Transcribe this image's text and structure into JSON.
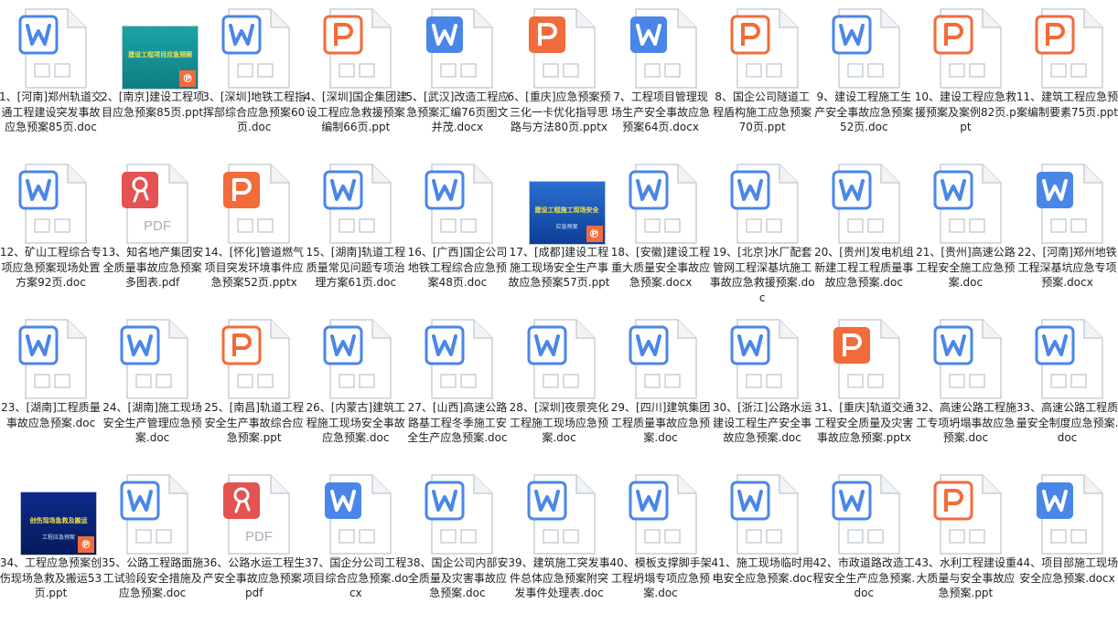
{
  "colors": {
    "word": "#4a86e8",
    "ppt": "#f26b3a",
    "pdf": "#e45252",
    "label_text": "#222222"
  },
  "files": [
    {
      "name": "1、[河南]郑州轨道交通工程建设突发事故应急预案85页.doc",
      "type": "doc",
      "icon": "word-outline-icon"
    },
    {
      "name": "2、[南京]建设工程项目应急预案85页.ppt",
      "type": "ppt",
      "icon": "slide-thumbnail",
      "thumb_text": "建设工程项目应急预案",
      "thumb_sub": ""
    },
    {
      "name": "3、[深圳]地铁工程指挥部综合应急预案60页.doc",
      "type": "doc",
      "icon": "word-outline-icon"
    },
    {
      "name": "4、[深圳]国企集团建设工程应急救援预案编制66页.ppt",
      "type": "ppt",
      "icon": "ppt-outline-icon"
    },
    {
      "name": "5、[武汉]改造工程应急预案汇编76页图文并茂.docx",
      "type": "docx",
      "icon": "word-solid-icon"
    },
    {
      "name": "6、[重庆]应急预案预三化一卡优化指导思路与方法80页.pptx",
      "type": "pptx",
      "icon": "ppt-solid-icon"
    },
    {
      "name": "7、工程项目管理现场生产安全事故应急预案64页.docx",
      "type": "docx",
      "icon": "word-solid-icon"
    },
    {
      "name": "8、国企公司隧道工程盾构施工应急预案70页.ppt",
      "type": "ppt",
      "icon": "ppt-outline-icon"
    },
    {
      "name": "9、建设工程施工生产安全事故应急预案52页.doc",
      "type": "doc",
      "icon": "word-outline-icon"
    },
    {
      "name": "10、建设工程应急救援预案及案例82页.ppt",
      "type": "ppt",
      "icon": "ppt-outline-icon"
    },
    {
      "name": "11、建筑工程应急预案编制要素75页.ppt",
      "type": "ppt",
      "icon": "ppt-outline-icon"
    },
    {
      "name": "12、矿山工程综合专项应急预案现场处置方案92页.doc",
      "type": "doc",
      "icon": "word-outline-icon"
    },
    {
      "name": "13、知名地产集团安全质量事故应急预案多图表.pdf",
      "type": "pdf",
      "icon": "pdf-icon",
      "pdf_text": "PDF"
    },
    {
      "name": "14、[怀化]管道燃气项目突发环境事件应急预案52页.pptx",
      "type": "pptx",
      "icon": "ppt-solid-icon"
    },
    {
      "name": "15、[湖南]轨道工程质量常见问题专项治理方案61页.doc",
      "type": "doc",
      "icon": "word-outline-icon"
    },
    {
      "name": "16、[广西]国企公司地铁工程综合应急预案48页.doc",
      "type": "doc",
      "icon": "word-outline-icon"
    },
    {
      "name": "17、[成都]建设工程施工现场安全生产事故应急预案57页.ppt",
      "type": "ppt",
      "icon": "slide-thumbnail",
      "thumb_text": "建设工程施工现场安全",
      "thumb_sub": "应急预案"
    },
    {
      "name": "18、[安徽]建设工程重大质量安全事故应急预案.docx",
      "type": "docx",
      "icon": "word-outline-icon"
    },
    {
      "name": "19、[北京]水厂配套管网工程深基坑施工事故应急救援预案.doc",
      "type": "doc",
      "icon": "word-outline-icon"
    },
    {
      "name": "20、[贵州]发电机组新建工程工程质量事故应急预案.doc",
      "type": "doc",
      "icon": "word-outline-icon"
    },
    {
      "name": "21、[贵州]高速公路工程安全施工应急预案.doc",
      "type": "doc",
      "icon": "word-outline-icon"
    },
    {
      "name": "22、[河南]郑州地铁工程深基坑应急专项预案.docx",
      "type": "docx",
      "icon": "word-solid-icon"
    },
    {
      "name": "23、[湖南]工程质量事故应急预案.doc",
      "type": "doc",
      "icon": "word-outline-icon"
    },
    {
      "name": "24、[湖南]施工现场安全生产管理应急预案.doc",
      "type": "doc",
      "icon": "word-outline-icon"
    },
    {
      "name": "25、[南昌]轨道工程安全生产事故综合应急预案.ppt",
      "type": "ppt",
      "icon": "ppt-outline-icon"
    },
    {
      "name": "26、[内蒙古]建筑工程施工现场安全事故应急预案.doc",
      "type": "doc",
      "icon": "word-outline-icon"
    },
    {
      "name": "27、[山西]高速公路路基工程冬季施工安全生产应急预案.doc",
      "type": "doc",
      "icon": "word-outline-icon"
    },
    {
      "name": "28、[深圳]夜景亮化工程施工现场应急预案.doc",
      "type": "doc",
      "icon": "word-outline-icon"
    },
    {
      "name": "29、[四川]建筑集团工程质量事故应急预案.doc",
      "type": "doc",
      "icon": "word-outline-icon"
    },
    {
      "name": "30、[浙江]公路水运建设工程生产安全事故应急预案.doc",
      "type": "doc",
      "icon": "word-outline-icon"
    },
    {
      "name": "31、[重庆]轨道交通工程安全质量及灾害事故应急预案.pptx",
      "type": "pptx",
      "icon": "ppt-solid-icon"
    },
    {
      "name": "32、高速公路工程施工专项坍塌事故应急预案.doc",
      "type": "doc",
      "icon": "word-outline-icon"
    },
    {
      "name": "33、高速公路工程质量安全制度应急预案.doc",
      "type": "doc",
      "icon": "word-outline-icon"
    },
    {
      "name": "34、工程应急预案创伤现场急救及搬运53页.ppt",
      "type": "ppt",
      "icon": "slide-thumbnail",
      "thumb_text": "创伤现场急救及搬运",
      "thumb_sub": "工程应急预案"
    },
    {
      "name": "35、公路工程路面施工试验段安全措施及应急预案.doc",
      "type": "doc",
      "icon": "word-outline-icon"
    },
    {
      "name": "36、公路水运工程生产安全事故应急预案.pdf",
      "type": "pdf",
      "icon": "pdf-icon",
      "pdf_text": "PDF"
    },
    {
      "name": "37、国企分公司工程项目综合应急预案.docx",
      "type": "docx",
      "icon": "word-solid-icon"
    },
    {
      "name": "38、国企公司内部安全质量及灾害事故应急预案.doc",
      "type": "doc",
      "icon": "word-outline-icon"
    },
    {
      "name": "39、建筑施工突发事件总体应急预案附突发事件处理表.doc",
      "type": "doc",
      "icon": "word-outline-icon"
    },
    {
      "name": "40、模板支撑脚手架工程坍塌专项应急预案.doc",
      "type": "doc",
      "icon": "word-outline-icon"
    },
    {
      "name": "41、施工现场临时用电安全应急预案.doc",
      "type": "doc",
      "icon": "word-outline-icon"
    },
    {
      "name": "42、市政道路改造工程安全生产应急预案.doc",
      "type": "doc",
      "icon": "word-outline-icon"
    },
    {
      "name": "43、水利工程建设重大质量与安全事故应急预案.ppt",
      "type": "ppt",
      "icon": "ppt-outline-icon"
    },
    {
      "name": "44、项目部施工现场安全应急预案.docx",
      "type": "docx",
      "icon": "word-solid-icon"
    }
  ]
}
